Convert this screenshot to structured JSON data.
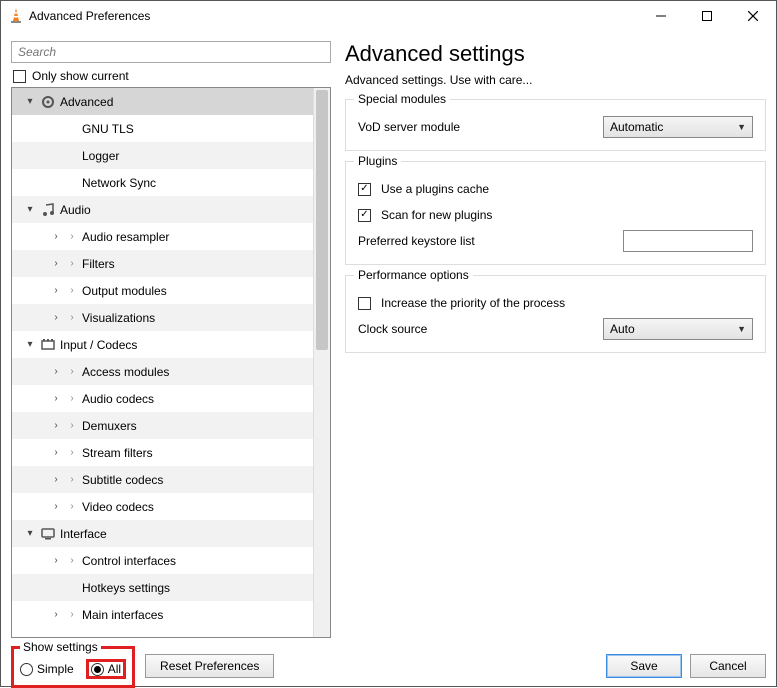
{
  "window": {
    "title": "Advanced Preferences"
  },
  "search": {
    "placeholder": "Search"
  },
  "only_show_current": "Only show current",
  "tree": [
    {
      "level": 0,
      "exp": "down",
      "icon": "gear",
      "label": "Advanced",
      "selected": true,
      "arrow": false
    },
    {
      "level": 1,
      "exp": "",
      "icon": "",
      "label": "GNU TLS",
      "arrow": false
    },
    {
      "level": 1,
      "exp": "",
      "icon": "",
      "label": "Logger",
      "arrow": false
    },
    {
      "level": 1,
      "exp": "",
      "icon": "",
      "label": "Network Sync",
      "arrow": false
    },
    {
      "level": 0,
      "exp": "down",
      "icon": "music",
      "label": "Audio",
      "arrow": false
    },
    {
      "level": 1,
      "exp": "right",
      "icon": "",
      "label": "Audio resampler",
      "arrow": true
    },
    {
      "level": 1,
      "exp": "right",
      "icon": "",
      "label": "Filters",
      "arrow": true
    },
    {
      "level": 1,
      "exp": "right",
      "icon": "",
      "label": "Output modules",
      "arrow": true
    },
    {
      "level": 1,
      "exp": "right",
      "icon": "",
      "label": "Visualizations",
      "arrow": true
    },
    {
      "level": 0,
      "exp": "down",
      "icon": "codec",
      "label": "Input / Codecs",
      "arrow": false
    },
    {
      "level": 1,
      "exp": "right",
      "icon": "",
      "label": "Access modules",
      "arrow": true
    },
    {
      "level": 1,
      "exp": "right",
      "icon": "",
      "label": "Audio codecs",
      "arrow": true
    },
    {
      "level": 1,
      "exp": "right",
      "icon": "",
      "label": "Demuxers",
      "arrow": true
    },
    {
      "level": 1,
      "exp": "right",
      "icon": "",
      "label": "Stream filters",
      "arrow": true
    },
    {
      "level": 1,
      "exp": "right",
      "icon": "",
      "label": "Subtitle codecs",
      "arrow": true
    },
    {
      "level": 1,
      "exp": "right",
      "icon": "",
      "label": "Video codecs",
      "arrow": true
    },
    {
      "level": 0,
      "exp": "down",
      "icon": "iface",
      "label": "Interface",
      "arrow": false
    },
    {
      "level": 1,
      "exp": "right",
      "icon": "",
      "label": "Control interfaces",
      "arrow": true
    },
    {
      "level": 1,
      "exp": "",
      "icon": "",
      "label": "Hotkeys settings",
      "arrow": false
    },
    {
      "level": 1,
      "exp": "right",
      "icon": "",
      "label": "Main interfaces",
      "arrow": true
    }
  ],
  "main": {
    "heading": "Advanced settings",
    "subheading": "Advanced settings. Use with care...",
    "group_special": {
      "title": "Special modules",
      "vod_label": "VoD server module",
      "vod_value": "Automatic"
    },
    "group_plugins": {
      "title": "Plugins",
      "use_cache": "Use a plugins cache",
      "scan_new": "Scan for new plugins",
      "keystore_label": "Preferred keystore list",
      "keystore_value": ""
    },
    "group_perf": {
      "title": "Performance options",
      "priority": "Increase the priority of the process",
      "clock_label": "Clock source",
      "clock_value": "Auto"
    }
  },
  "bottom": {
    "show_settings": "Show settings",
    "simple": "Simple",
    "all": "All",
    "reset": "Reset Preferences",
    "save": "Save",
    "cancel": "Cancel"
  }
}
